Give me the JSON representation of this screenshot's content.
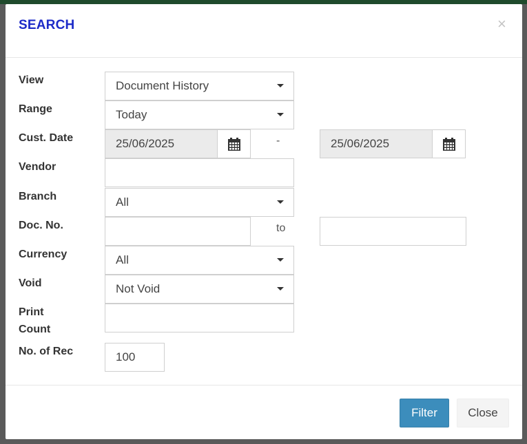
{
  "modal": {
    "title": "SEARCH",
    "close_symbol": "×"
  },
  "form": {
    "view": {
      "label": "View",
      "value": "Document History"
    },
    "range": {
      "label": "Range",
      "value": "Today"
    },
    "cust_date": {
      "label": "Cust. Date",
      "from": "25/06/2025",
      "separator": "-",
      "to": "25/06/2025",
      "icon": "calendar-icon"
    },
    "vendor": {
      "label": "Vendor",
      "value": ""
    },
    "branch": {
      "label": "Branch",
      "value": "All"
    },
    "doc_no": {
      "label": "Doc. No.",
      "from": "",
      "separator": "to",
      "to": ""
    },
    "currency": {
      "label": "Currency",
      "value": "All"
    },
    "void": {
      "label": "Void",
      "value": "Not Void"
    },
    "print_count": {
      "label_line1": "Print",
      "label_line2": "Count",
      "value": ""
    },
    "no_of_rec": {
      "label": "No. of Rec",
      "value": "100"
    }
  },
  "footer": {
    "filter_label": "Filter",
    "close_label": "Close"
  },
  "colors": {
    "title": "#1d2bc8",
    "primary_button": "#3c8dbc",
    "top_bar": "#1f4a2c",
    "backdrop": "#5a5a5a"
  }
}
